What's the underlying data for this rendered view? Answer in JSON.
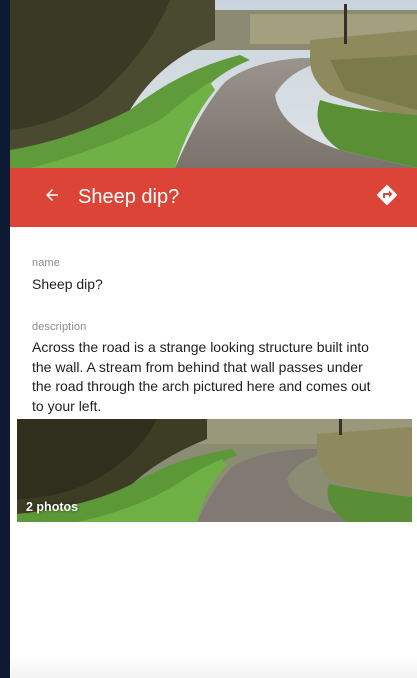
{
  "place": {
    "title": "Sheep dip?",
    "name_label": "name",
    "name_value": "Sheep dip?",
    "description_label": "description",
    "description_value": "Across the road is a strange looking structure built into the wall. A stream from behind that wall passes under the road through the arch pictured here and comes out to your left.",
    "photo_count": "2 photos"
  },
  "icons": {
    "back": "arrow-left-icon",
    "directions": "directions-icon"
  },
  "colors": {
    "app_bar": "#db4437",
    "left_edge": "#0e1a33"
  }
}
